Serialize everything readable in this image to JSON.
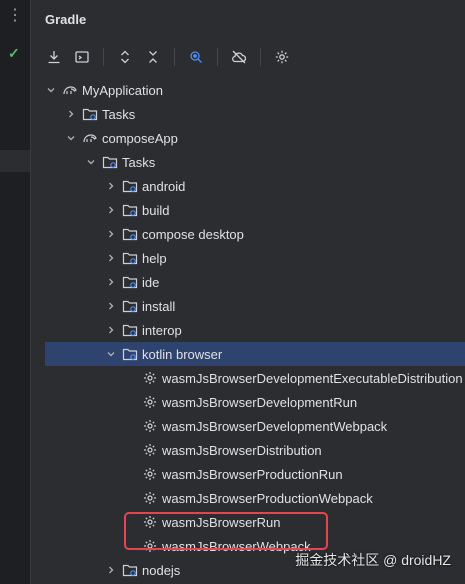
{
  "panel": {
    "title": "Gradle"
  },
  "toolbar": {
    "icons": [
      "download-icon",
      "run-config-icon",
      "expand-all-icon",
      "collapse-all-icon",
      "analyze-dependencies-icon",
      "offline-mode-icon",
      "settings-icon"
    ]
  },
  "tree": {
    "root": {
      "label": "MyApplication"
    },
    "root_tasks": {
      "label": "Tasks"
    },
    "compose_app": {
      "label": "composeApp"
    },
    "tasks": {
      "label": "Tasks"
    },
    "groups": [
      {
        "label": "android"
      },
      {
        "label": "build"
      },
      {
        "label": "compose desktop"
      },
      {
        "label": "help"
      },
      {
        "label": "ide"
      },
      {
        "label": "install"
      },
      {
        "label": "interop"
      }
    ],
    "selected_group": {
      "label": "kotlin browser"
    },
    "items": [
      {
        "label": "wasmJsBrowserDevelopmentExecutableDistribution"
      },
      {
        "label": "wasmJsBrowserDevelopmentRun"
      },
      {
        "label": "wasmJsBrowserDevelopmentWebpack"
      },
      {
        "label": "wasmJsBrowserDistribution"
      },
      {
        "label": "wasmJsBrowserProductionRun"
      },
      {
        "label": "wasmJsBrowserProductionWebpack"
      },
      {
        "label": "wasmJsBrowserRun"
      },
      {
        "label": "wasmJsBrowserWebpack"
      }
    ],
    "after_group": {
      "label": "nodejs"
    }
  },
  "watermark": "掘金技术社区 @ droidHZ",
  "colors": {
    "selection": "#2e436e",
    "highlight": "#e5454c",
    "accent_blue": "#548af7"
  }
}
